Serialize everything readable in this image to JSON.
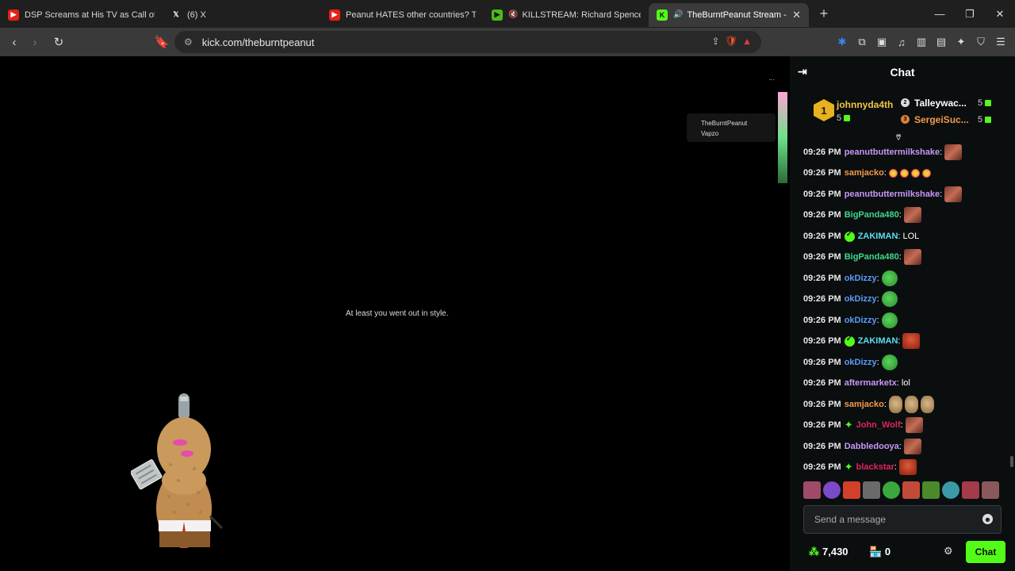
{
  "browser": {
    "tabs": [
      {
        "title": "DSP Screams at His TV as Call of Duty",
        "favicon": "youtube-icon",
        "active": false
      },
      {
        "title": "(6) X",
        "favicon": "x-icon",
        "active": false
      },
      {
        "title": "Peanut HATES other countries? THE T",
        "favicon": "youtube-icon",
        "active": false
      },
      {
        "title": "KILLSTREAM: Richard Spencer Liv",
        "favicon": "rumble-icon",
        "active": false
      },
      {
        "title": "TheBurntPeanut Stream - Wat",
        "favicon": "kick-icon",
        "active": true
      }
    ],
    "url": "kick.com/theburntpeanut"
  },
  "video": {
    "overlay_line1": "TheBurntPeanut",
    "overlay_line2": "Vapzo",
    "subtitle": "At least you went out in style."
  },
  "chat": {
    "title": "Chat",
    "leaderboard": [
      {
        "rank": "1",
        "name": "johnnyda4th",
        "count": "5"
      },
      {
        "name": "Talleywac...",
        "count": "5"
      },
      {
        "name": "SergeiSuc...",
        "count": "5"
      }
    ],
    "messages": [
      {
        "time": "09:26 PM",
        "user": "peanutbuttermilkshake",
        "color": "#c797f7",
        "text": "",
        "emotes": [
          "face"
        ]
      },
      {
        "time": "09:26 PM",
        "user": "samjacko",
        "color": "#f29a4a",
        "text": "",
        "emotes": [
          "smile",
          "smile",
          "smile",
          "smile"
        ]
      },
      {
        "time": "09:26 PM",
        "user": "peanutbuttermilkshake",
        "color": "#c797f7",
        "text": "",
        "emotes": [
          "face"
        ]
      },
      {
        "time": "09:26 PM",
        "user": "BigPanda480",
        "color": "#3fd88a",
        "text": "",
        "emotes": [
          "face"
        ]
      },
      {
        "time": "09:26 PM",
        "user": "ZAKIMAN",
        "color": "#58e0f0",
        "text": "LOL",
        "emotes": [],
        "badge": "verified"
      },
      {
        "time": "09:26 PM",
        "user": "BigPanda480",
        "color": "#3fd88a",
        "text": "",
        "emotes": [
          "face"
        ]
      },
      {
        "time": "09:26 PM",
        "user": "okDizzy",
        "color": "#5a9cf5",
        "text": "",
        "emotes": [
          "pepe"
        ]
      },
      {
        "time": "09:26 PM",
        "user": "okDizzy",
        "color": "#5a9cf5",
        "text": "",
        "emotes": [
          "pepe"
        ]
      },
      {
        "time": "09:26 PM",
        "user": "okDizzy",
        "color": "#5a9cf5",
        "text": "",
        "emotes": [
          "pepe"
        ]
      },
      {
        "time": "09:26 PM",
        "user": "ZAKIMAN",
        "color": "#58e0f0",
        "text": "",
        "emotes": [
          "red"
        ],
        "badge": "verified"
      },
      {
        "time": "09:26 PM",
        "user": "okDizzy",
        "color": "#5a9cf5",
        "text": "",
        "emotes": [
          "pepe"
        ]
      },
      {
        "time": "09:26 PM",
        "user": "aftermarketx",
        "color": "#c797f7",
        "text": "lol",
        "emotes": []
      },
      {
        "time": "09:26 PM",
        "user": "samjacko",
        "color": "#f29a4a",
        "text": "",
        "emotes": [
          "nut",
          "nut",
          "nut"
        ]
      },
      {
        "time": "09:26 PM",
        "user": "John_Wolf",
        "color": "#e0245e",
        "text": "",
        "emotes": [
          "face"
        ],
        "badge": "sub"
      },
      {
        "time": "09:26 PM",
        "user": "Dabbledooya",
        "color": "#c797f7",
        "text": "",
        "emotes": [
          "face"
        ]
      },
      {
        "time": "09:26 PM",
        "user": "blackstar",
        "color": "#e0245e",
        "text": "",
        "emotes": [
          "red"
        ],
        "badge": "sub"
      }
    ],
    "input_placeholder": "Send a message",
    "points": "7,430",
    "store_count": "0",
    "send_label": "Chat"
  }
}
